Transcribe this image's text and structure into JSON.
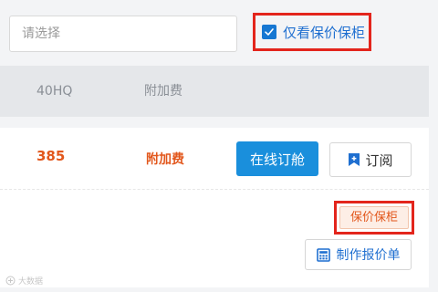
{
  "filter": {
    "select_placeholder": "请选择",
    "only_insured_label": "仅看保价保柜",
    "only_insured_checked": true
  },
  "table": {
    "columns": [
      "40HQ",
      "附加费"
    ]
  },
  "row": {
    "price_40hq": "385",
    "surcharge": "附加费",
    "book_online_label": "在线订舱",
    "subscribe_label": "订阅",
    "insured_badge": "保价保柜",
    "make_quote_label": "制作报价单"
  },
  "watermark": {
    "text": "大数据"
  },
  "colors": {
    "accent_blue": "#1a8fdc",
    "price_orange": "#e2571c",
    "highlight_red": "#e3251c"
  },
  "icons": [
    "checkbox-checked-icon",
    "bookmark-plus-icon",
    "calculator-icon",
    "watermark-logo-icon"
  ]
}
